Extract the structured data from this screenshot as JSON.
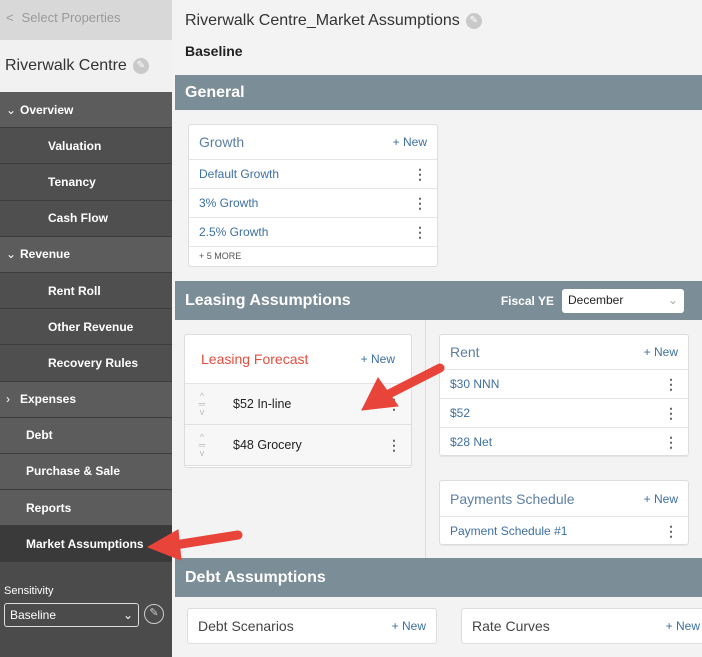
{
  "sidebar": {
    "back_label": "Select Properties",
    "property_name": "Riverwalk Centre",
    "nav": [
      {
        "label": "Overview",
        "type": "group"
      },
      {
        "label": "Valuation",
        "type": "sub"
      },
      {
        "label": "Tenancy",
        "type": "sub"
      },
      {
        "label": "Cash Flow",
        "type": "sub"
      },
      {
        "label": "Revenue",
        "type": "group"
      },
      {
        "label": "Rent Roll",
        "type": "sub"
      },
      {
        "label": "Other Revenue",
        "type": "sub"
      },
      {
        "label": "Recovery Rules",
        "type": "sub"
      },
      {
        "label": "Expenses",
        "type": "collapsed"
      },
      {
        "label": "Debt",
        "type": "top"
      },
      {
        "label": "Purchase & Sale",
        "type": "top"
      },
      {
        "label": "Reports",
        "type": "top"
      },
      {
        "label": "Market Assumptions",
        "type": "active"
      }
    ],
    "sensitivity_label": "Sensitivity",
    "sensitivity_value": "Baseline"
  },
  "main": {
    "title": "Riverwalk Centre_Market Assumptions",
    "subtitle": "Baseline",
    "general": {
      "heading": "General",
      "growth": {
        "title": "Growth",
        "new": "+ New",
        "items": [
          "Default Growth",
          "3% Growth",
          "2.5% Growth"
        ],
        "more": "+ 5 MORE"
      }
    },
    "leasing": {
      "heading": "Leasing Assumptions",
      "fiscal_label": "Fiscal YE",
      "fiscal_value": "December",
      "forecast": {
        "title": "Leasing Forecast",
        "new": "+ New",
        "items": [
          "$52 In-line",
          "$48 Grocery"
        ]
      },
      "rent": {
        "title": "Rent",
        "new": "+ New",
        "items": [
          "$30 NNN",
          "$52",
          "$28 Net"
        ]
      },
      "payments": {
        "title": "Payments Schedule",
        "new": "+ New",
        "items": [
          "Payment Schedule #1"
        ]
      }
    },
    "debt": {
      "heading": "Debt Assumptions",
      "scenarios": {
        "title": "Debt Scenarios",
        "new": "+ New"
      },
      "curves": {
        "title": "Rate Curves",
        "new": "+ New"
      }
    }
  },
  "colors": {
    "section_bar": "#7b8d96",
    "link": "#3e6fa3",
    "active_card_title": "#e84c3d",
    "annotation_arrow": "#e8443a"
  }
}
